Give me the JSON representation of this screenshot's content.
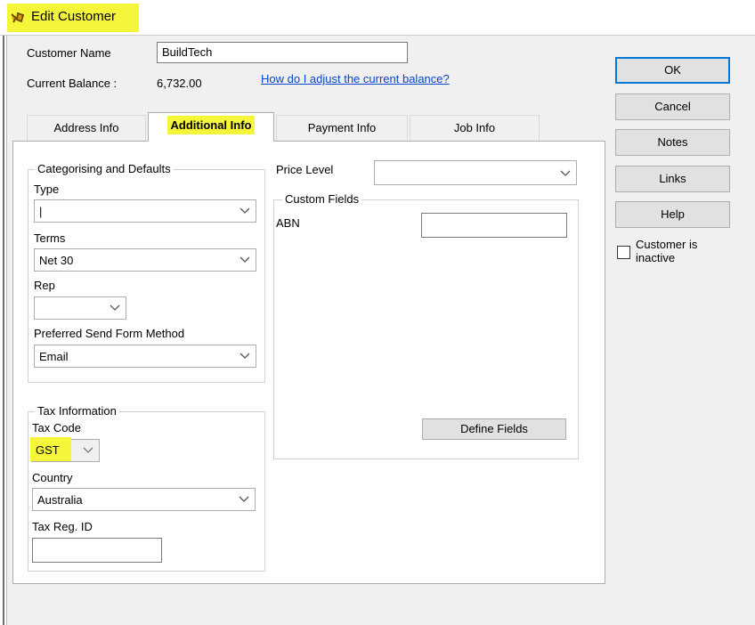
{
  "window": {
    "title": "Edit Customer"
  },
  "header": {
    "customer_name_label": "Customer Name",
    "customer_name_value": "BuildTech",
    "balance_label": "Current Balance :",
    "balance_value": "6,732.00",
    "balance_link": "How do I adjust the current balance?"
  },
  "tabs": [
    {
      "label": "Address Info",
      "active": false
    },
    {
      "label": "Additional Info",
      "active": true
    },
    {
      "label": "Payment Info",
      "active": false
    },
    {
      "label": "Job Info",
      "active": false
    }
  ],
  "categorising": {
    "group_title": "Categorising and Defaults",
    "type_label": "Type",
    "type_value": "|",
    "terms_label": "Terms",
    "terms_value": "Net 30",
    "rep_label": "Rep",
    "rep_value": "",
    "send_method_label": "Preferred Send Form Method",
    "send_method_value": "Email"
  },
  "tax": {
    "group_title": "Tax Information",
    "tax_code_label": "Tax Code",
    "tax_code_value": "GST",
    "country_label": "Country",
    "country_value": "Australia",
    "tax_reg_label": "Tax Reg. ID",
    "tax_reg_value": ""
  },
  "price_level": {
    "label": "Price Level",
    "value": ""
  },
  "custom_fields": {
    "group_title": "Custom Fields",
    "abn_label": "ABN",
    "abn_value": "",
    "define_button": "Define Fields"
  },
  "buttons": {
    "ok": "OK",
    "cancel": "Cancel",
    "notes": "Notes",
    "links": "Links",
    "help": "Help"
  },
  "inactive": {
    "label_line1": "Customer is",
    "label_line2": "inactive",
    "checked": false
  },
  "colors": {
    "highlight": "#f5f53a",
    "link": "#0645d0",
    "accent": "#0078d7"
  },
  "icons": {
    "title_icon": "customer-icon",
    "dropdown_arrow": "chevron-down-icon"
  }
}
